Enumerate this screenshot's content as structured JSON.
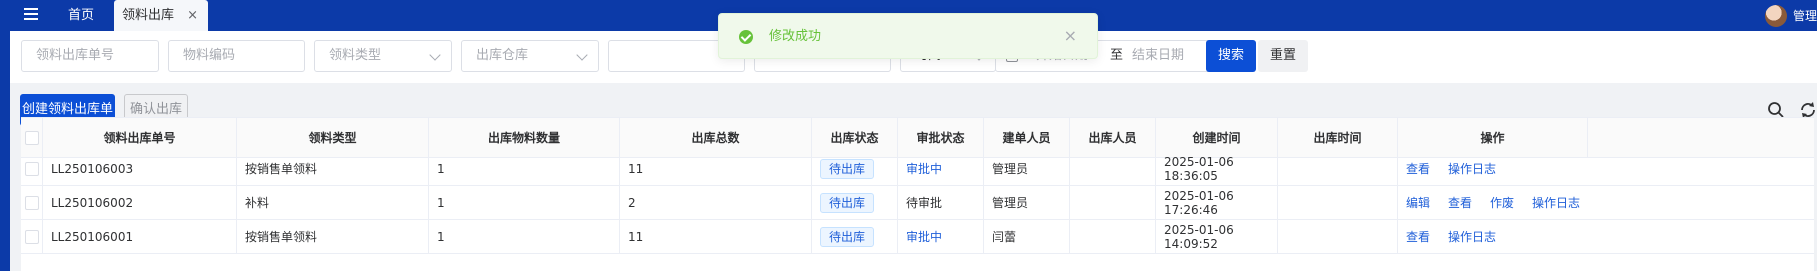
{
  "nav": {
    "home": "首页",
    "active_tab": "领料出库",
    "close_glyph": "×",
    "user_name": "管理"
  },
  "toast": {
    "message": "修改成功",
    "close_glyph": "×",
    "color": "#67c23a"
  },
  "filters": {
    "order_no": "领料出库单号",
    "material_code": "物料编码",
    "pick_type": "领料类型",
    "warehouse": "出库仓库",
    "f5": "",
    "f6": "",
    "time_type": "时间",
    "date_start": "开始日期",
    "date_sep": "至",
    "date_end": "结束日期",
    "search": "搜索",
    "reset": "重置"
  },
  "toolbar": {
    "create": "创建领料出库单",
    "confirm": "确认出库"
  },
  "table": {
    "headers": [
      "领料出库单号",
      "领料类型",
      "出库物料数量",
      "出库总数",
      "出库状态",
      "审批状态",
      "建单人员",
      "出库人员",
      "创建时间",
      "出库时间",
      "操作"
    ],
    "rows": [
      {
        "order_no": "LL250106003",
        "type": "按销售单领料",
        "qty": "1",
        "total": "11",
        "out_status": "待出库",
        "approve": "审批中",
        "creator": "管理员",
        "out_user": "",
        "created": "2025-01-06 18:36:05",
        "out_time": "",
        "actions": [
          "查看",
          "操作日志"
        ]
      },
      {
        "order_no": "LL250106002",
        "type": "补料",
        "qty": "1",
        "total": "2",
        "out_status": "待出库",
        "approve": "待审批",
        "creator": "管理员",
        "out_user": "",
        "created": "2025-01-06 17:26:46",
        "out_time": "",
        "actions": [
          "编辑",
          "查看",
          "作废",
          "操作日志"
        ]
      },
      {
        "order_no": "LL250106001",
        "type": "按销售单领料",
        "qty": "1",
        "total": "11",
        "out_status": "待出库",
        "approve": "审批中",
        "creator": "闫蕾",
        "out_user": "",
        "created": "2025-01-06 14:09:52",
        "out_time": "",
        "actions": [
          "查看",
          "操作日志"
        ]
      }
    ]
  },
  "colors": {
    "primary": "#0c4fd6",
    "nav": "#0c3aa8",
    "success": "#67c23a",
    "link": "#2160d9"
  }
}
